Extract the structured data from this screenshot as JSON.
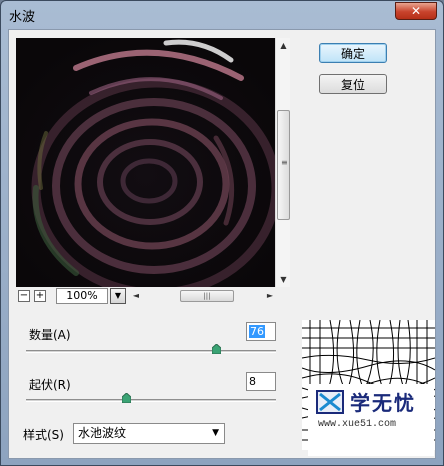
{
  "window": {
    "title": "水波",
    "close_glyph": "✕"
  },
  "buttons": {
    "ok_label": "确定",
    "reset_label": "复位"
  },
  "zoom": {
    "minus": "−",
    "plus": "+",
    "level": "100%",
    "dropdown_glyph": "▼"
  },
  "scroll": {
    "up": "▲",
    "down": "▼",
    "left": "◄",
    "right": "►",
    "v_grip": "≡",
    "h_grip": "|||"
  },
  "params": {
    "amount": {
      "label": "数量(A)",
      "value": "76",
      "slider_fraction": 0.76
    },
    "ridges": {
      "label": "起伏(R)",
      "value": "8",
      "slider_fraction": 0.4
    }
  },
  "style": {
    "label": "样式(S)",
    "selected": "水池波纹",
    "caret": "▼"
  },
  "watermark": {
    "brand": "学无忧",
    "url": "www.xue51.com"
  },
  "colors": {
    "ok_border": "#3c7fb1",
    "close_red": "#c8432c",
    "slider_thumb": "#3aa374"
  }
}
